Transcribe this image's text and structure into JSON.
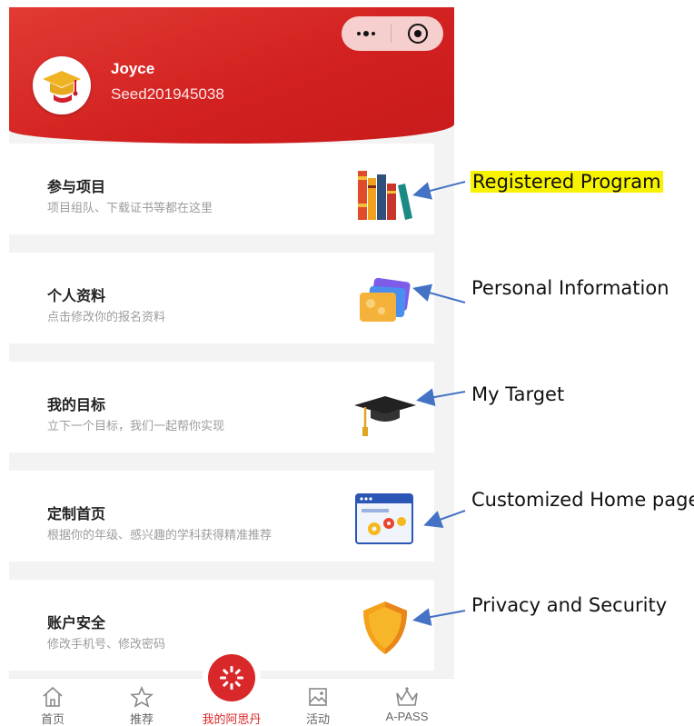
{
  "header": {
    "user_name": "Joyce",
    "user_id": "Seed201945038",
    "capsule": {
      "more_icon": "more-dots-icon",
      "close_icon": "target-circle-icon"
    }
  },
  "menu": [
    {
      "title": "参与项目",
      "subtitle": "项目组队、下载证书等都在这里",
      "icon": "books-icon"
    },
    {
      "title": "个人资料",
      "subtitle": "点击修改你的报名资料",
      "icon": "profile-cards-icon"
    },
    {
      "title": "我的目标",
      "subtitle": "立下一个目标，我们一起帮你实现",
      "icon": "graduation-cap-icon"
    },
    {
      "title": "定制首页",
      "subtitle": "根据你的年级、感兴趣的学科获得精准推荐",
      "icon": "settings-window-icon"
    },
    {
      "title": "账户安全",
      "subtitle": "修改手机号、修改密码",
      "icon": "shield-icon"
    }
  ],
  "tabbar": [
    {
      "label": "首页",
      "icon": "home-icon"
    },
    {
      "label": "推荐",
      "icon": "star-icon"
    },
    {
      "label": "我的阿思丹",
      "icon": "brand-logo-icon",
      "active": true
    },
    {
      "label": "活动",
      "icon": "image-icon"
    },
    {
      "label": "A-PASS",
      "icon": "crown-icon"
    }
  ],
  "annotations": [
    {
      "text": "Registered Program",
      "highlight": true
    },
    {
      "text": "Personal Information"
    },
    {
      "text": "My Target"
    },
    {
      "text": "Customized Home page"
    },
    {
      "text": "Privacy and Security"
    }
  ],
  "colors": {
    "header_red": "#d1201f",
    "accent_red": "#d8282a",
    "highlight_yellow": "#f7f300",
    "arrow_blue": "#4472c4"
  }
}
